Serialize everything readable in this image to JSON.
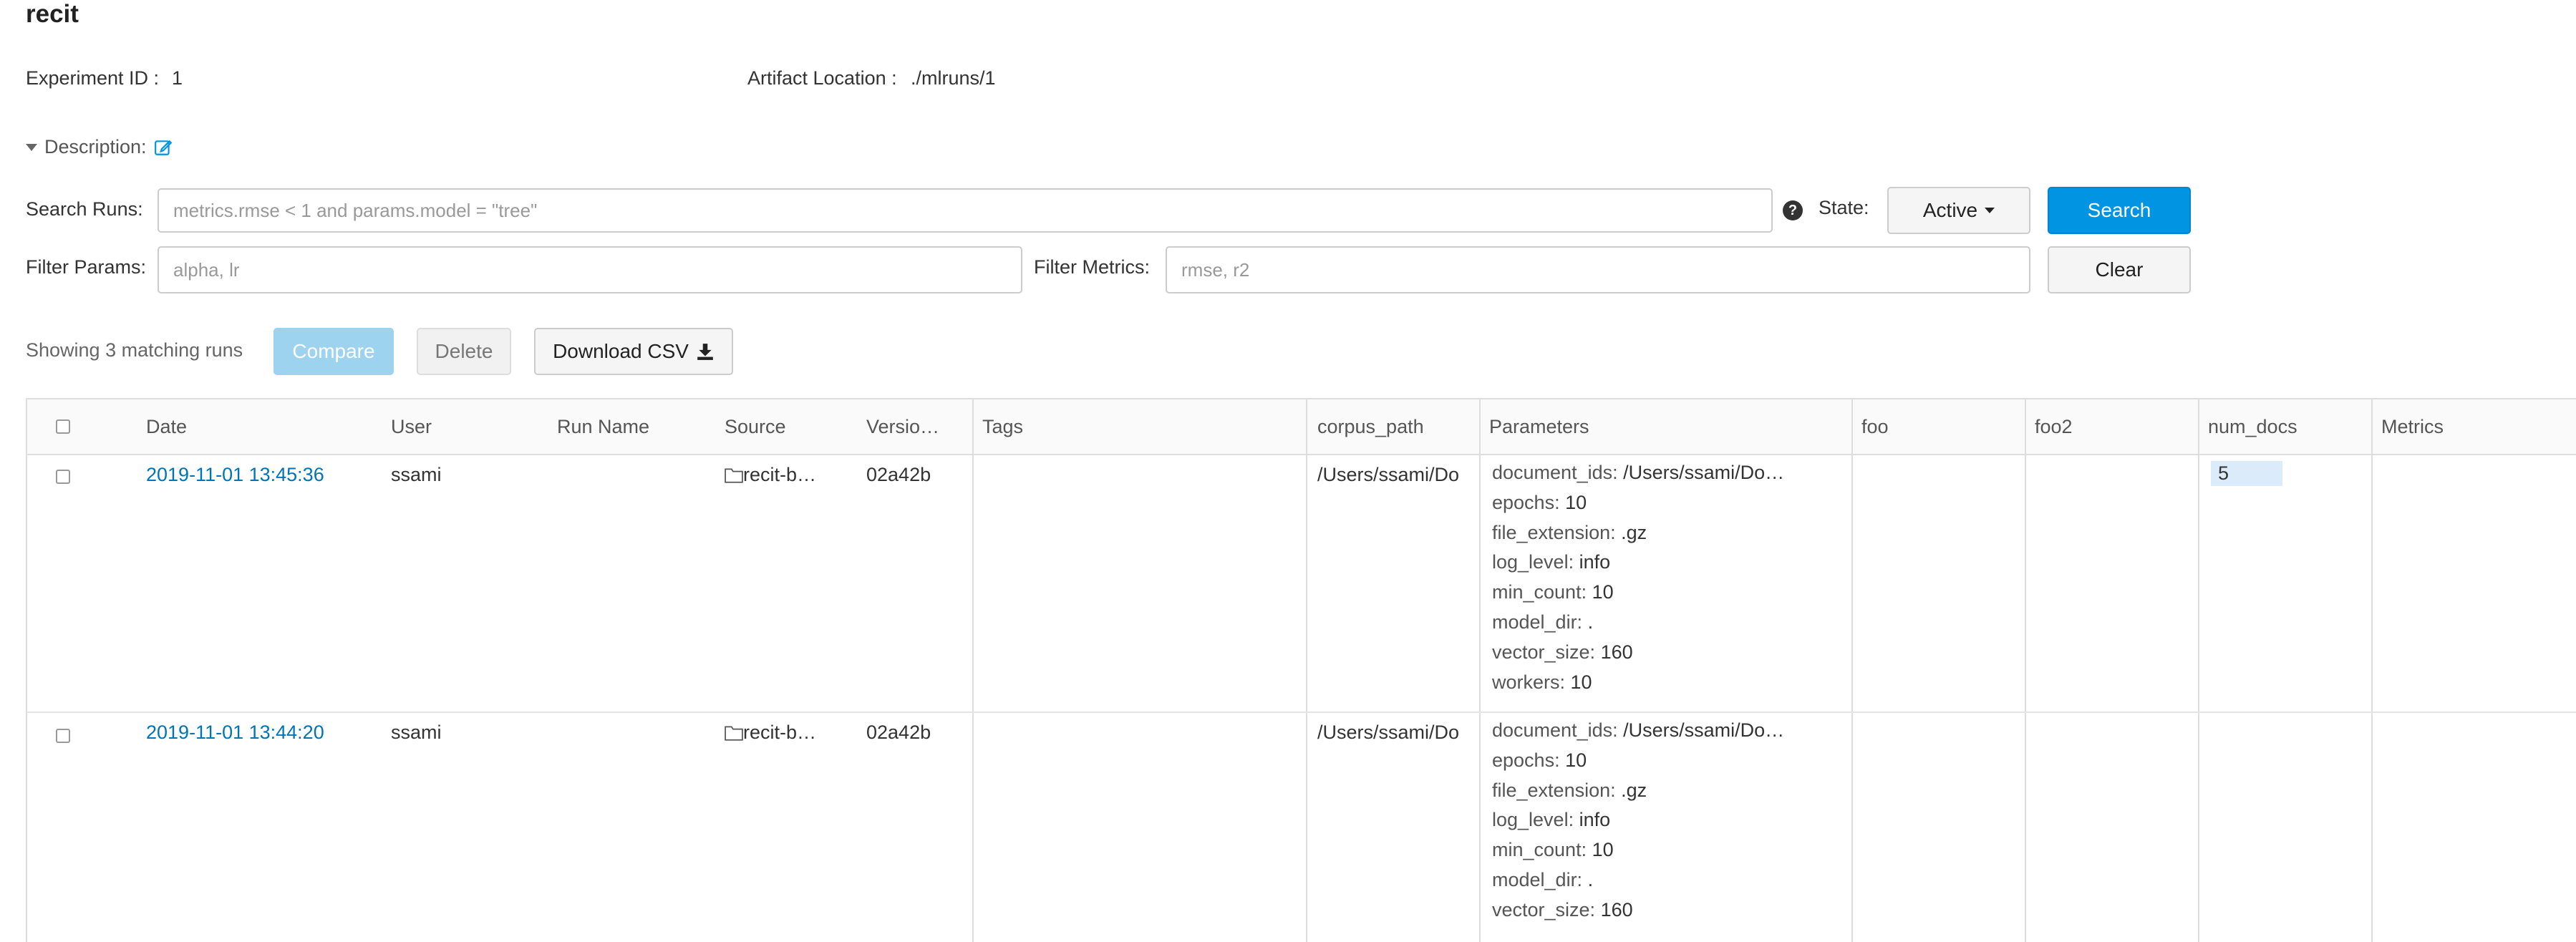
{
  "experiment": {
    "name": "recit",
    "id_label": "Experiment ID :",
    "id_value": "1",
    "artifact_label": "Artifact Location :",
    "artifact_value": "./mlruns/1",
    "description_label": "Description:"
  },
  "search": {
    "runs_label": "Search Runs:",
    "runs_placeholder": "metrics.rmse < 1 and params.model = \"tree\"",
    "state_label": "State:",
    "state_value": "Active",
    "search_button": "Search",
    "filter_params_label": "Filter Params:",
    "filter_params_placeholder": "alpha, lr",
    "filter_metrics_label": "Filter Metrics:",
    "filter_metrics_placeholder": "rmse, r2",
    "clear_button": "Clear"
  },
  "toolbar": {
    "showing_text": "Showing 3 matching runs",
    "compare": "Compare",
    "delete": "Delete",
    "download": "Download CSV"
  },
  "table": {
    "columns": [
      "Date",
      "User",
      "Run Name",
      "Source",
      "Versio…",
      "Tags",
      "corpus_path",
      "Parameters",
      "foo",
      "foo2",
      "num_docs",
      "Metrics"
    ],
    "rows": [
      {
        "date": "2019-11-01 13:45:36",
        "user": "ssami",
        "source": "recit-b…",
        "version": "02a42b",
        "corpus_path": "/Users/ssami/Do",
        "num_docs": "5",
        "params": [
          {
            "k": "document_ids:",
            "v": "/Users/ssami/Do…"
          },
          {
            "k": "epochs:",
            "v": "10"
          },
          {
            "k": "file_extension:",
            "v": ".gz"
          },
          {
            "k": "log_level:",
            "v": "info"
          },
          {
            "k": "min_count:",
            "v": "10"
          },
          {
            "k": "model_dir:",
            "v": "."
          },
          {
            "k": "vector_size:",
            "v": "160"
          },
          {
            "k": "workers:",
            "v": "10"
          }
        ]
      },
      {
        "date": "2019-11-01 13:44:20",
        "user": "ssami",
        "source": "recit-b…",
        "version": "02a42b",
        "corpus_path": "/Users/ssami/Do",
        "num_docs": "",
        "params": [
          {
            "k": "document_ids:",
            "v": "/Users/ssami/Do…"
          },
          {
            "k": "epochs:",
            "v": "10"
          },
          {
            "k": "file_extension:",
            "v": ".gz"
          },
          {
            "k": "log_level:",
            "v": "info"
          },
          {
            "k": "min_count:",
            "v": "10"
          },
          {
            "k": "model_dir:",
            "v": "."
          },
          {
            "k": "vector_size:",
            "v": "160"
          }
        ]
      }
    ]
  },
  "colors": {
    "primary": "#0194e2",
    "link": "#0174b8",
    "highlight": "#dcebfa"
  }
}
